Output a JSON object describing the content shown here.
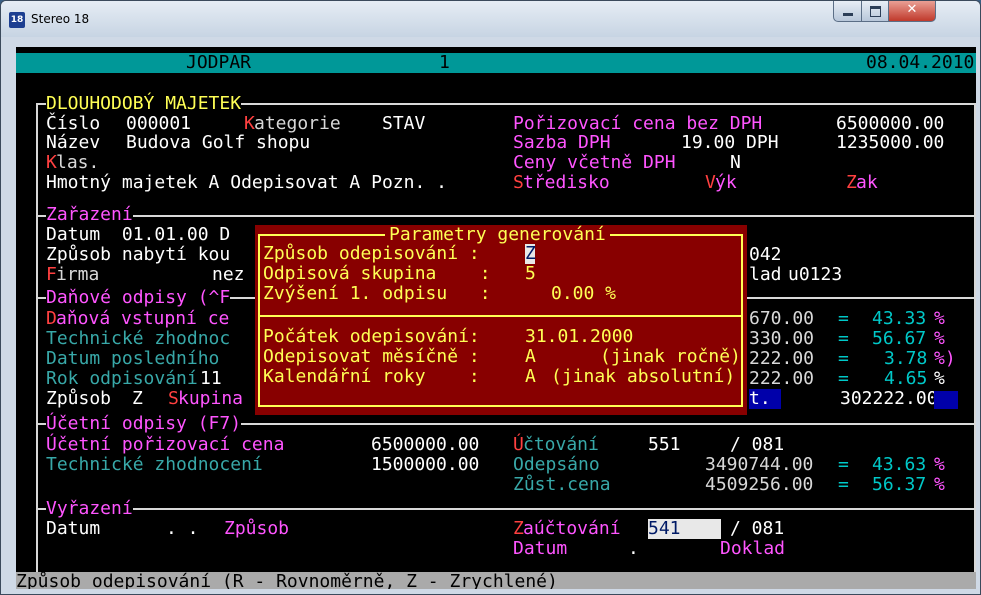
{
  "window": {
    "title": "Stereo 18",
    "icon_text": "18"
  },
  "header": {
    "module": "JODPAR",
    "number": "1",
    "date": "08.04.2010"
  },
  "section_asset": {
    "title": "DLOUHODOBÝ MAJETEK",
    "cislo_label": "Číslo",
    "cislo_value": "000001",
    "kategorie_hot": "K",
    "kategorie_rest": "ategorie",
    "kategorie_value": "STAV",
    "nazev_label": "Název",
    "nazev_value": "Budova Golf shopu",
    "klas_hot": "K",
    "klas_rest": "las.",
    "hmotny_line": "Hmotný majetek A Odepisovat A Pozn. .",
    "cena_label": "Pořizovací cena bez DPH",
    "cena_value": "6500000.00",
    "sazba_label": "Sazba DPH",
    "sazba_value": "19.00 DPH",
    "dph_value": "1235000.00",
    "ceny_label": "Ceny včetně DPH",
    "ceny_value": "N",
    "stredisko_hot": "S",
    "stredisko_rest": "tředisko",
    "vyk_hot": "V",
    "vyk_rest": "ýk",
    "zak_hot": "Z",
    "zak_rest": "ak"
  },
  "section_zarazeni": {
    "title": "Zařazení",
    "datum_line": "Datum  01.01.00 D",
    "zpusob_line": "Způsob nabytí kou",
    "firma_hot": "F",
    "firma_rest": "irma",
    "firma_value": "nez",
    "right_042": "042",
    "doklad_label": "lad",
    "doklad_value": "u0123"
  },
  "section_danove": {
    "title": "Daňové odpisy (^F",
    "d_hot": "D",
    "d_rest": "aňová vstupní ce",
    "technicke": "Technické zhodnoc",
    "datum_posl": "Datum posledního",
    "rok_label": "Rok odpisování",
    "rok_value": "11",
    "zpusob_label": "Způsob",
    "zpusob_value": "Z",
    "skupina_hot": "S",
    "skupina_rest": "kupina",
    "rows": [
      {
        "amount": "670.00",
        "eq": "=",
        "pct": "43.33",
        "unit": "%"
      },
      {
        "amount": "330.00",
        "eq": "=",
        "pct": "56.67",
        "unit": "%"
      },
      {
        "amount": "222.00",
        "eq": "=",
        "pct": "3.78",
        "unit": "%)"
      },
      {
        "amount": "222.00",
        "eq": "=",
        "pct": "4.65",
        "unit": "%"
      }
    ],
    "t_char": "t.",
    "total": "302222.00"
  },
  "section_ucetni": {
    "title": "Účetní odpisy (F7)",
    "poriz_label": "Účetní pořizovací cena",
    "poriz_value": "6500000.00",
    "tech_label": "Technické zhodnocení",
    "tech_value": "1500000.00",
    "uct_hot": "Ú",
    "uct_rest": "čtování",
    "uct_value": "551",
    "uct_slash": "/ 081",
    "odepsano_label": "Odepsáno",
    "odepsano_value": "3490744.00",
    "odepsano_pct": "43.63",
    "zust_label": "Zůst.cena",
    "zust_value": "4509256.00",
    "zust_pct": "56.37",
    "eq": "=",
    "unit": "%"
  },
  "section_vyrazeni": {
    "title": "Vyřazení",
    "datum_label": "Datum",
    "datum_value": ". .",
    "zpusob_label": "Způsob",
    "zauct_hot": "Z",
    "zauct_rest": "aúčtování",
    "zauct_value": "541",
    "zauct_slash": "/ 081",
    "datum2_label": "Datum",
    "datum2_value": ".",
    "doklad_label": "Doklad"
  },
  "dialog": {
    "title": "Parametry generování",
    "zpusob_label": "Způsob odepisování :",
    "zpusob_value": "Z",
    "skupina_label": "Odpisová skupina    :",
    "skupina_value": "5",
    "zvyseni_label": "Zvýšení 1. odpisu   :",
    "zvyseni_value": "0.00 %",
    "pocatek_label": "Počátek odepisování:",
    "pocatek_value": "31.01.2000",
    "mesicne_label": "Odepisovat měsíčně :",
    "mesicne_value": "A",
    "mesicne_note": "(jinak ročně)",
    "kalendar_label": "Kalendářní roky    :",
    "kalendar_value": "A",
    "kalendar_note": "(jinak absolutní)"
  },
  "status": {
    "hint": "Způsob odepisování (R - Rovnoměrně, Z - Zrychlené)"
  },
  "colors": {
    "background": "#000000",
    "header_bar": "#009898",
    "dialog": "#880000",
    "dialog_text": "#ffff55",
    "label": "#ff55ff",
    "hotkey": "#ff4040"
  }
}
